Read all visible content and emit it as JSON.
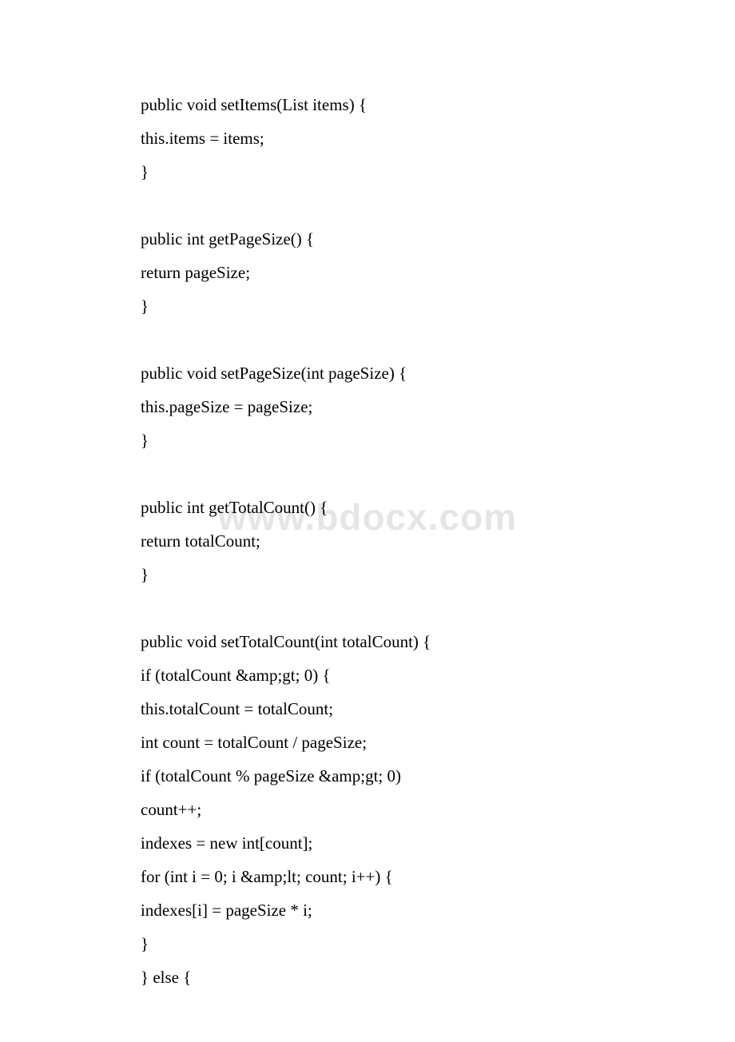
{
  "watermark": "www.bdocx.com",
  "code": {
    "lines": [
      "public void setItems(List items) {",
      "this.items = items;",
      "}",
      "",
      "public int getPageSize() {",
      "return pageSize;",
      "}",
      "",
      "public void setPageSize(int pageSize) {",
      "this.pageSize = pageSize;",
      "}",
      "",
      "public int getTotalCount() {",
      "return totalCount;",
      "}",
      "",
      "public void setTotalCount(int totalCount) {",
      "if (totalCount &amp;gt; 0) {",
      "this.totalCount = totalCount;",
      "int count = totalCount / pageSize;",
      "if (totalCount % pageSize &amp;gt; 0)",
      "count++;",
      "indexes = new int[count];",
      "for (int i = 0; i &amp;lt; count; i++) {",
      "indexes[i] = pageSize * i;",
      "}",
      "} else {"
    ]
  }
}
